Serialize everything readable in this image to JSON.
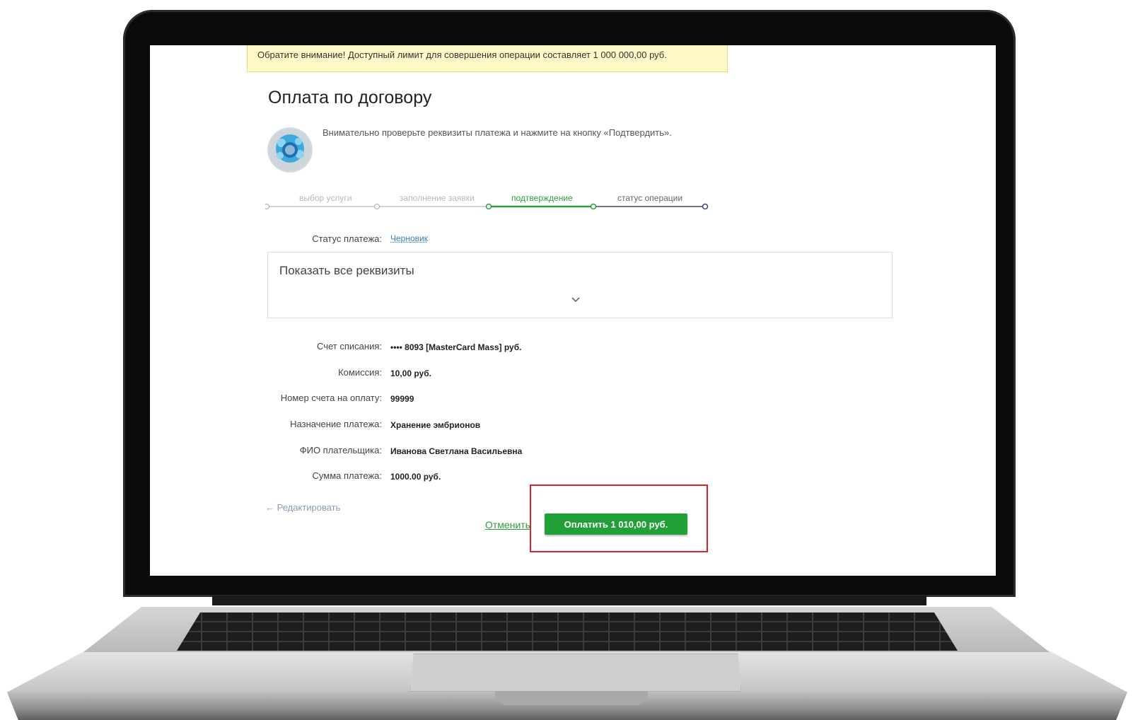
{
  "notice": {
    "text": "Обратите внимание! Доступный лимит для совершения операции составляет 1 000 000,00 руб."
  },
  "page": {
    "title": "Оплата по договору",
    "hint": "Внимательно проверьте реквизиты платежа и нажмите на кнопку «Подтвердить».",
    "avatar_icon": "service-logo-icon"
  },
  "steps": [
    {
      "label": "выбор услуги",
      "state": "done"
    },
    {
      "label": "заполнение заявки",
      "state": "done"
    },
    {
      "label": "подтверждение",
      "state": "active"
    },
    {
      "label": "статус операции",
      "state": "next"
    }
  ],
  "status": {
    "label": "Статус платежа:",
    "value": "Черновик"
  },
  "details": {
    "toggle_label": "Показать все реквизиты"
  },
  "fields": [
    {
      "label": "Счет списания:",
      "value": "•••• 8093  [MasterCard Mass]  руб."
    },
    {
      "label": "Комиссия:",
      "value": "10,00 руб."
    },
    {
      "label": "Номер счета на оплату:",
      "value": "99999"
    },
    {
      "label": "Назначение платежа:",
      "value": "Хранение эмбрионов"
    },
    {
      "label": "ФИО плательщика:",
      "value": "Иванова Светлана Васильевна"
    },
    {
      "label": "Сумма платежа:",
      "value": "1000.00 руб."
    }
  ],
  "actions": {
    "edit_label": "← Редактировать",
    "cancel_label": "Отменить",
    "pay_label": "Оплатить 1 010,00 руб."
  },
  "colors": {
    "accent": "#21a038",
    "highlight": "#d3262f",
    "notice_bg": "#fff9c7"
  }
}
